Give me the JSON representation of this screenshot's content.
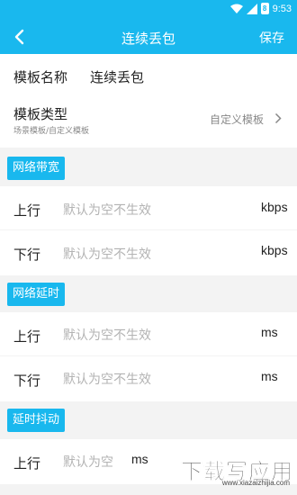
{
  "status_bar": {
    "time": "9:53",
    "battery_level": "8"
  },
  "app_bar": {
    "title": "连续丢包",
    "save_label": "保存"
  },
  "template_name": {
    "label": "模板名称",
    "value": "连续丢包"
  },
  "template_type": {
    "label": "模板类型",
    "subtitle": "场景模板/自定义模板",
    "value": "自定义模板"
  },
  "sections": {
    "bandwidth": {
      "title": "网络带宽",
      "uplink": {
        "label": "上行",
        "placeholder": "默认为空不生效",
        "unit": "kbps"
      },
      "downlink": {
        "label": "下行",
        "placeholder": "默认为空不生效",
        "unit": "kbps"
      }
    },
    "delay": {
      "title": "网络延时",
      "uplink": {
        "label": "上行",
        "placeholder": "默认为空不生效",
        "unit": "ms"
      },
      "downlink": {
        "label": "下行",
        "placeholder": "默认为空不生效",
        "unit": "ms"
      }
    },
    "jitter": {
      "title": "延时抖动",
      "uplink": {
        "label": "上行",
        "placeholder": "默认为空",
        "unit": "ms"
      }
    }
  },
  "watermark": {
    "text": "下载写应用",
    "url": "www.xiazaizhijia.com"
  },
  "colors": {
    "accent": "#19b8ee",
    "placeholder": "#b3b3b3",
    "background": "#f3f3f3"
  }
}
